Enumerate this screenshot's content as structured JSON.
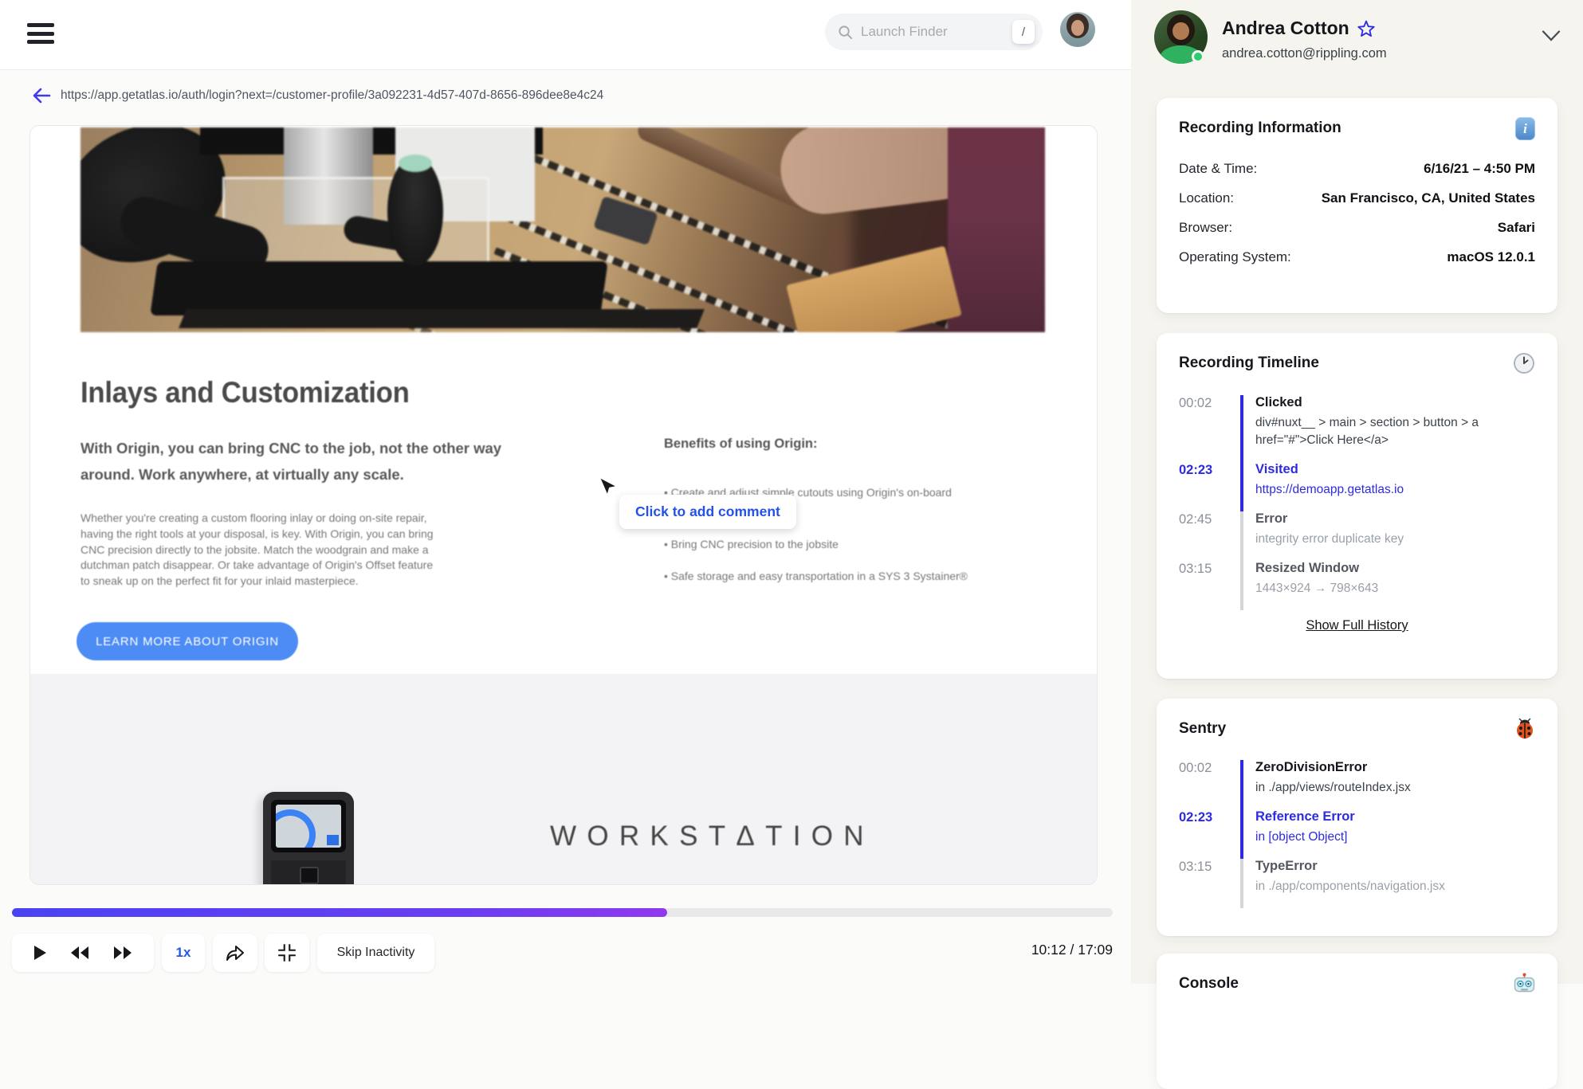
{
  "topbar": {
    "search": {
      "placeholder": "Launch Finder",
      "shortcut_key": "/"
    }
  },
  "url_bar": {
    "url": "https://app.getatlas.io/auth/login?next=/customer-profile/3a092231-4d57-407d-8656-896dee8e4c24"
  },
  "website": {
    "heading": "Inlays and Customization",
    "intro": "With Origin, you can bring CNC to the job, not the other way around. Work anywhere, at virtually any scale.",
    "paragraph": "Whether you're creating a custom flooring inlay or doing on-site repair, having the right tools at your disposal, is key. With Origin, you can bring CNC precision directly to the jobsite. Match the woodgrain and make a dutchman patch disappear. Or take advantage of Origin's Offset feature to sneak up on the perfect fit for your inlaid masterpiece.",
    "benefits_title": "Benefits of using Origin:",
    "benefits": [
      "Create and adjust simple cutouts using Origin's on-board\nno computer required",
      "Bring CNC precision to the jobsite",
      "Safe storage and easy transportation in a SYS 3 Systainer®"
    ],
    "cta_label": "LEARN MORE ABOUT ORIGIN",
    "brand": "WORKSTΔTION",
    "comment_tooltip": "Click to add comment"
  },
  "player": {
    "current_time": "10:12",
    "total_time": "17:09",
    "time_display": "10:12 / 17:09",
    "progress_percent": 59.5,
    "progress_style": "width:59.5%",
    "speed_label": "1x",
    "skip_label": "Skip Inactivity"
  },
  "profile": {
    "name": "Andrea Cotton",
    "email": "andrea.cotton@rippling.com",
    "status_color": "#2ecc71",
    "accent_blue": "#2d2be0"
  },
  "recording_information": {
    "title": "Recording Information",
    "icon": "info-badge",
    "rows": [
      {
        "label": "Date & Time:",
        "value": "6/16/21 – 4:50 PM"
      },
      {
        "label": "Location:",
        "value": "San Francisco, CA, United States"
      },
      {
        "label": "Browser:",
        "value": "Safari"
      },
      {
        "label": "Operating System:",
        "value": "macOS 12.0.1"
      }
    ]
  },
  "recording_timeline": {
    "title": "Recording Timeline",
    "icon": "clock",
    "events": [
      {
        "time": "00:02",
        "title": "Clicked",
        "desc": "div#nuxt__ > main > section > button > a href=\"#\">Click Here</a>",
        "state": "past"
      },
      {
        "time": "02:23",
        "title": "Visited",
        "desc": "https://demoapp.getatlas.io",
        "state": "active"
      },
      {
        "time": "02:45",
        "title": "Error",
        "desc": "integrity error duplicate key",
        "state": "future"
      },
      {
        "time": "03:15",
        "title": "Resized Window",
        "desc": "1443×924 → 798×643",
        "state": "future"
      }
    ],
    "footer_link": "Show Full History"
  },
  "sentry": {
    "title": "Sentry",
    "icon": "ladybug",
    "events": [
      {
        "time": "00:02",
        "title": "ZeroDivisionError",
        "desc": "in ./app/views/routeIndex.jsx",
        "state": "past"
      },
      {
        "time": "02:23",
        "title": "Reference Error",
        "desc": "in [object Object]",
        "state": "active"
      },
      {
        "time": "03:15",
        "title": "TypeError",
        "desc": "in ./app/components/navigation.jsx",
        "state": "future"
      }
    ]
  },
  "console": {
    "title": "Console",
    "icon": "robot"
  }
}
